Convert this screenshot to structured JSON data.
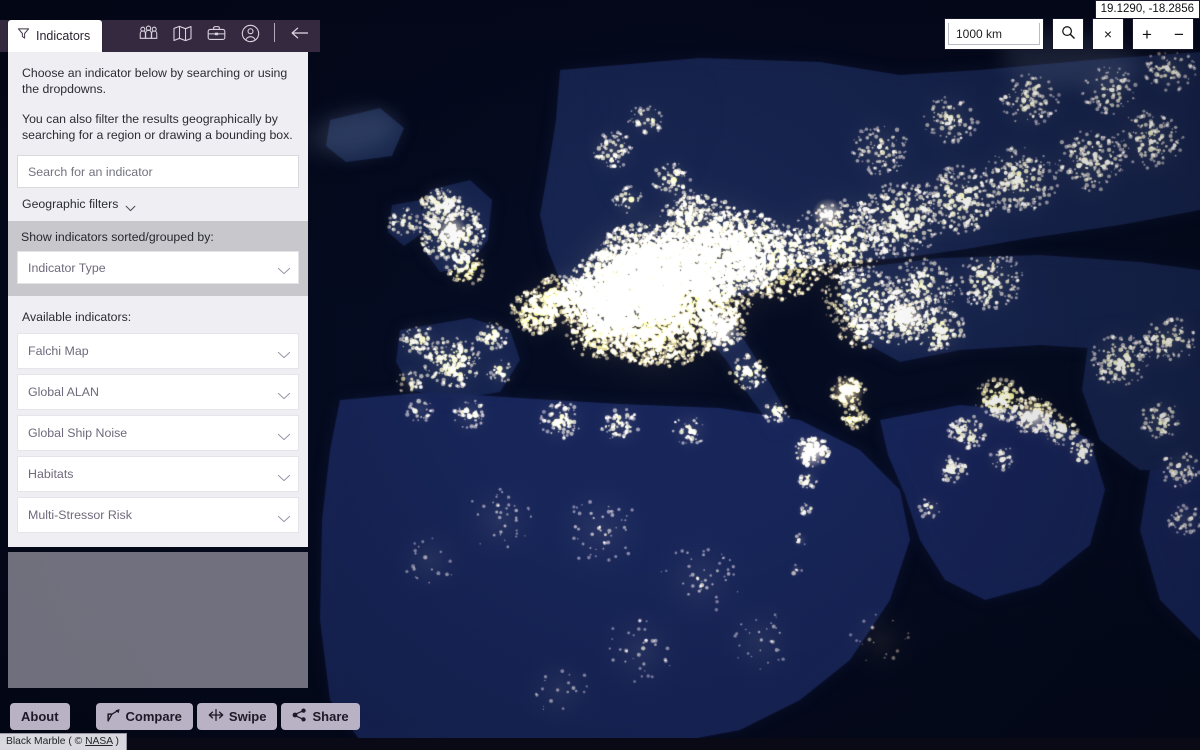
{
  "panel": {
    "tab": {
      "label": "Indicators",
      "icon": "filter-funnel-icon"
    },
    "header_icons": [
      {
        "name": "people-group-icon",
        "title": "Community"
      },
      {
        "name": "folded-map-icon",
        "title": "Map"
      },
      {
        "name": "briefcase-icon",
        "title": "Toolbox"
      },
      {
        "name": "user-account-icon",
        "title": "Account"
      },
      {
        "name": "collapse-left-arrow-icon",
        "title": "Collapse panel"
      }
    ],
    "intro_paragraph_1": "Choose an indicator below by searching or using the dropdowns.",
    "intro_paragraph_2": "You can also filter the results geographically by searching for a region or drawing a bounding box.",
    "search": {
      "placeholder": "Search for an indicator",
      "value": ""
    },
    "geographic_filters_label": "Geographic filters",
    "sort_section_label": "Show indicators sorted/grouped by:",
    "sort_select_value": "Indicator Type",
    "available_label": "Available indicators:",
    "indicators": [
      {
        "label": "Falchi Map"
      },
      {
        "label": "Global ALAN"
      },
      {
        "label": "Global Ship Noise"
      },
      {
        "label": "Habitats"
      },
      {
        "label": "Multi-Stressor Risk"
      }
    ]
  },
  "bottom_bar": {
    "about_label": "About",
    "compare_label": "Compare",
    "swipe_label": "Swipe",
    "share_label": "Share"
  },
  "map_controls": {
    "coordinates": "19.1290, -18.2856",
    "scale_label": "1000 km",
    "search_icon": "magnifier-icon",
    "clear_label": "×",
    "zoom_in_label": "+",
    "zoom_out_label": "−"
  },
  "attribution": {
    "prefix": "Black Marble ( © ",
    "link": "NASA",
    "suffix": " )"
  },
  "colors": {
    "header_purple": "#352940",
    "panel_bg": "#efeff3",
    "sortbar_gray": "#c8c8cc",
    "button_lavender": "#b9b2c4",
    "map_ocean_deep": "#040a1e",
    "map_land": "#16224a",
    "map_lights": "#ffe8b0"
  }
}
